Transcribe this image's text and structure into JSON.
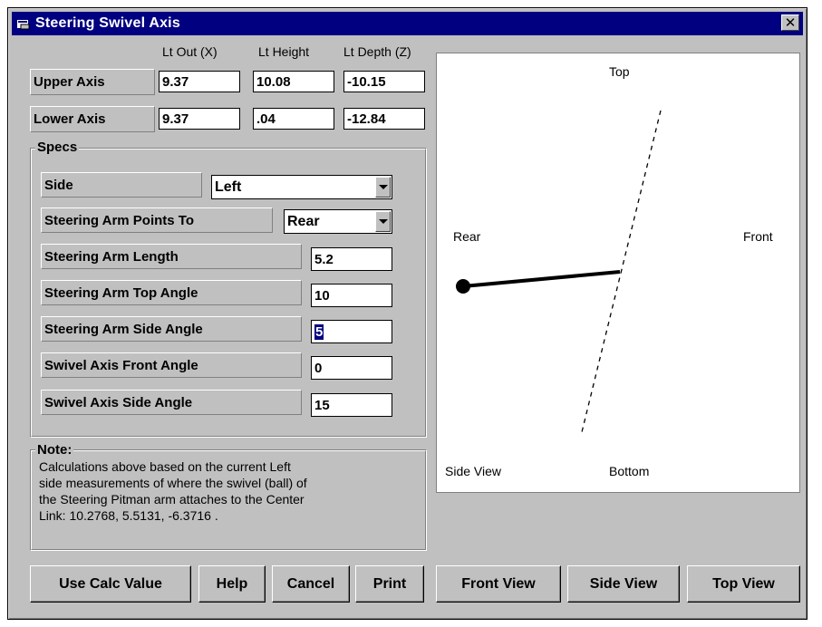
{
  "window": {
    "title": "Steering Swivel Axis",
    "close_glyph": "✕"
  },
  "columns": {
    "x": "Lt Out (X)",
    "height": "Lt Height",
    "depth": "Lt Depth (Z)"
  },
  "upper_axis": {
    "label": "Upper Axis",
    "x": "9.37",
    "height": "10.08",
    "depth": "-10.15"
  },
  "lower_axis": {
    "label": "Lower Axis",
    "x": "9.37",
    "height": ".04",
    "depth": "-12.84"
  },
  "specs": {
    "title": "Specs",
    "side_label": "Side",
    "side_value": "Left",
    "arm_points_label": "Steering Arm Points To",
    "arm_points_value": "Rear",
    "arm_length_label": "Steering Arm Length",
    "arm_length_value": "5.2",
    "arm_top_angle_label": "Steering Arm Top Angle",
    "arm_top_angle_value": "10",
    "arm_side_angle_label": "Steering Arm Side Angle",
    "arm_side_angle_value": "5",
    "swivel_front_angle_label": "Swivel Axis Front Angle",
    "swivel_front_angle_value": "0",
    "swivel_side_angle_label": "Swivel Axis Side Angle",
    "swivel_side_angle_value": "15"
  },
  "note": {
    "title": "Note:",
    "line1": "Calculations above based on the current Left",
    "line2": "side measurements of where the swivel (ball) of",
    "line3": "the Steering Pitman arm attaches to the Center",
    "line4": "Link: 10.2768, 5.5131, -6.3716 ."
  },
  "view": {
    "top": "Top",
    "bottom": "Bottom",
    "rear": "Rear",
    "front": "Front",
    "mode": "Side View"
  },
  "buttons": {
    "use_calc": "Use Calc Value",
    "help": "Help",
    "cancel": "Cancel",
    "print": "Print",
    "front_view": "Front View",
    "side_view": "Side View",
    "top_view": "Top View"
  },
  "colors": {
    "titlebar": "#000080",
    "face": "#c0c0c0",
    "selection": "#000080"
  }
}
